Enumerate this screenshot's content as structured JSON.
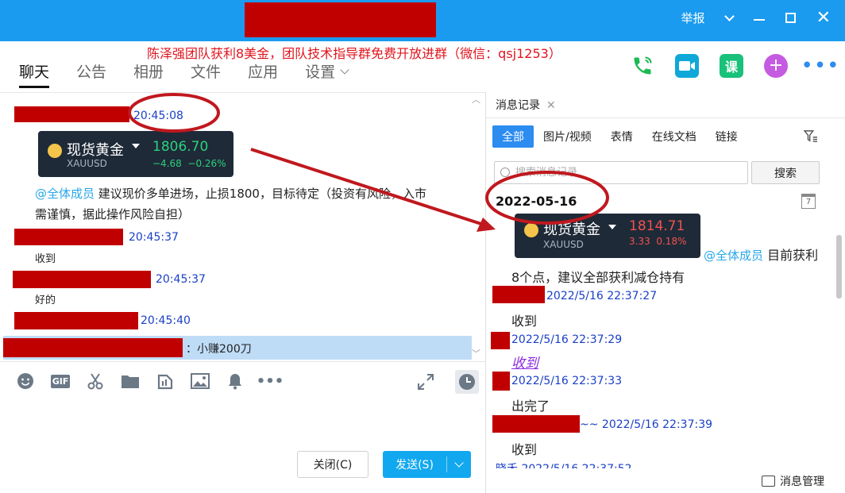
{
  "titlebar": {
    "report": "举报"
  },
  "banner": "陈泽强团队获利8美金，团队技术指导群免费开放进群（微信：qsj1253）",
  "tabs": [
    {
      "label": "聊天"
    },
    {
      "label": "公告"
    },
    {
      "label": "相册"
    },
    {
      "label": "文件"
    },
    {
      "label": "应用"
    },
    {
      "label": "设置"
    }
  ],
  "nav_icons": [
    "phone-icon",
    "video-icon",
    "course-icon",
    "plus-icon",
    "more-icon"
  ],
  "course_label": "课",
  "chat": {
    "ts1": "20:45:08",
    "card": {
      "name": "现货黄金",
      "price": "1806.70",
      "code": "XAUUSD",
      "change": "−4.68",
      "pct": "−0.26%"
    },
    "mention": "@全体成员",
    "advice_line1": "建议现价多单进场，止损1800，目标待定（投资有风险，入市",
    "advice_line2": "需谨慎，据此操作风险自担）",
    "ts2": "20:45:37",
    "msg2": "收到",
    "ts3": "20:45:37",
    "msg3": "好的",
    "ts4": "20:45:40",
    "highlight": "：小赚200刀"
  },
  "toolbar": {
    "icons": [
      "emoji-icon",
      "gif-icon",
      "scissors-icon",
      "folder-icon",
      "rich-text-icon",
      "image-icon",
      "bell-icon",
      "more-dots-icon"
    ],
    "gif": "GIF",
    "close_label": "关闭(C)",
    "send_label": "发送(S)"
  },
  "panel": {
    "tab_title": "消息记录",
    "filters": [
      "全部",
      "图片/视频",
      "表情",
      "在线文档",
      "链接"
    ],
    "search_placeholder": "搜索消息记录",
    "search_button": "搜索",
    "date": "2022-05-16",
    "calendar_day": "7",
    "card": {
      "name": "现货黄金",
      "price": "1814.71",
      "code": "XAUUSD",
      "change": "3.33",
      "pct": "0.18%"
    },
    "mention": "@全体成员",
    "msg_tail": "目前获利",
    "msg_line2": "8个点，建议全部获利减仓持有",
    "ts1": "2022/5/16 22:37:27",
    "m1": "收到",
    "ts2": "2022/5/16 22:37:29",
    "m2": "收到",
    "ts3": "2022/5/16 22:37:33",
    "m3": "出完了",
    "ts4": "~~ 2022/5/16 22:37:39",
    "m4": "收到",
    "ts5_partial": "晓禾 2022/5/16 22:37:52",
    "footer": "消息管理"
  },
  "colors": {
    "titlebar": "#1a9bf0",
    "redaction": "#c00000",
    "annotation": "#c0181e",
    "link": "#1a3fc6",
    "send": "#12a8ef"
  }
}
